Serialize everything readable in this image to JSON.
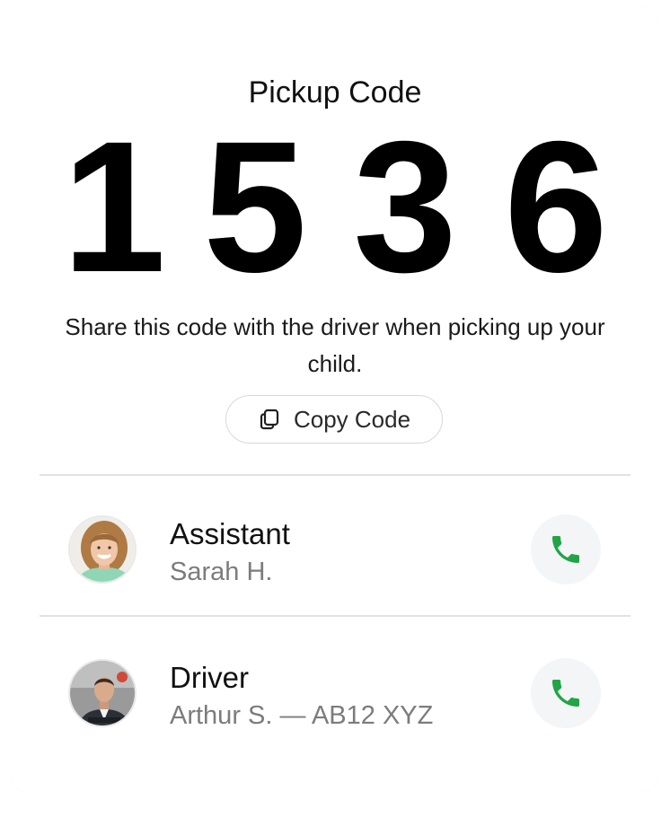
{
  "card": {
    "title": "Pickup Code",
    "code_digits": [
      "1",
      "5",
      "3",
      "6"
    ],
    "instruction": "Share this code with the driver when picking up your child.",
    "copy_button": {
      "label": "Copy Code",
      "icon": "copy-icon"
    }
  },
  "contacts": [
    {
      "role": "Assistant",
      "name": "Sarah H.",
      "call_icon": "phone-icon"
    },
    {
      "role": "Driver",
      "name": "Arthur S. — AB12 XYZ",
      "call_icon": "phone-icon"
    }
  ],
  "colors": {
    "call_icon": "#22A447",
    "call_button_bg": "#F3F5F7",
    "secondary_text": "#7C7C7C",
    "divider": "#E2E2E2"
  }
}
